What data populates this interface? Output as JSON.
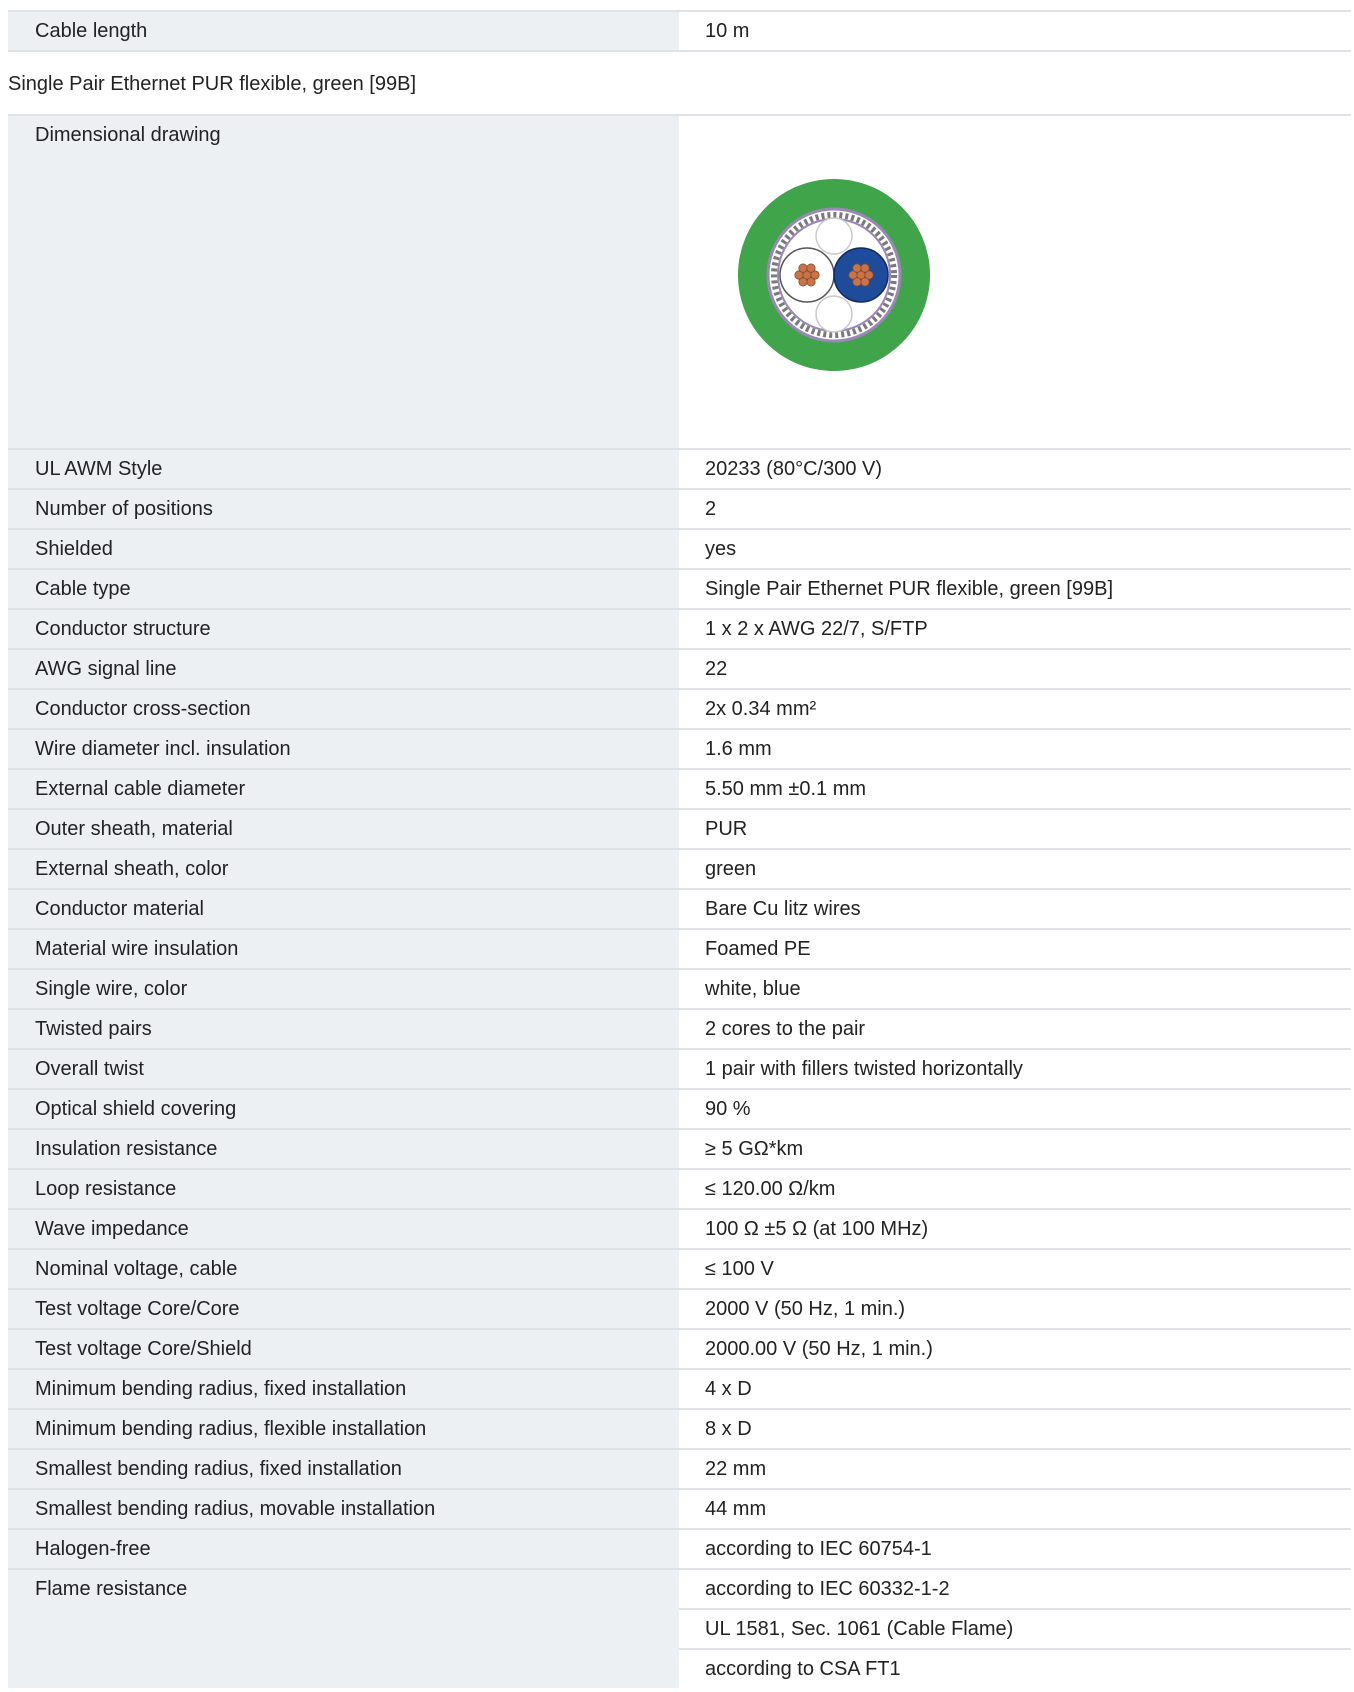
{
  "top_row": {
    "label": "Cable length",
    "value": "10 m"
  },
  "section": {
    "title": "Single Pair Ethernet PUR flexible, green [99B]",
    "drawing_label": "Dimensional drawing",
    "drawing_colors": {
      "sheath": "#3fa44a",
      "shield": "#9c86b8",
      "wire_white": "#ffffff",
      "wire_blue": "#1e4b9a",
      "copper": "#c8744a"
    },
    "rows": [
      {
        "label": "UL AWM Style",
        "values": [
          "20233 (80°C/300 V)"
        ]
      },
      {
        "label": "Number of positions",
        "values": [
          "2"
        ]
      },
      {
        "label": "Shielded",
        "values": [
          "yes"
        ]
      },
      {
        "label": "Cable type",
        "values": [
          "Single Pair Ethernet PUR flexible, green [99B]"
        ]
      },
      {
        "label": "Conductor structure",
        "values": [
          "1 x 2 x AWG 22/7, S/FTP"
        ]
      },
      {
        "label": "AWG signal line",
        "values": [
          "22"
        ]
      },
      {
        "label": "Conductor cross-section",
        "values": [
          "2x 0.34 mm²"
        ]
      },
      {
        "label": "Wire diameter incl. insulation",
        "values": [
          "1.6 mm"
        ]
      },
      {
        "label": "External cable diameter",
        "values": [
          "5.50 mm ±0.1 mm"
        ]
      },
      {
        "label": "Outer sheath, material",
        "values": [
          "PUR"
        ]
      },
      {
        "label": "External sheath, color",
        "values": [
          "green"
        ]
      },
      {
        "label": "Conductor material",
        "values": [
          "Bare Cu litz wires"
        ]
      },
      {
        "label": "Material wire insulation",
        "values": [
          "Foamed PE"
        ]
      },
      {
        "label": "Single wire, color",
        "values": [
          "white, blue"
        ]
      },
      {
        "label": "Twisted pairs",
        "values": [
          "2 cores to the pair"
        ]
      },
      {
        "label": "Overall twist",
        "values": [
          "1 pair with fillers twisted horizontally"
        ]
      },
      {
        "label": "Optical shield covering",
        "values": [
          "90 %"
        ]
      },
      {
        "label": "Insulation resistance",
        "values": [
          "≥ 5 GΩ*km"
        ]
      },
      {
        "label": "Loop resistance",
        "values": [
          "≤ 120.00 Ω/km"
        ]
      },
      {
        "label": "Wave impedance",
        "values": [
          "100 Ω ±5 Ω (at 100 MHz)"
        ]
      },
      {
        "label": "Nominal voltage, cable",
        "values": [
          "≤ 100 V"
        ]
      },
      {
        "label": "Test voltage Core/Core",
        "values": [
          "2000 V (50 Hz, 1 min.)"
        ]
      },
      {
        "label": "Test voltage Core/Shield",
        "values": [
          "2000.00 V (50 Hz, 1 min.)"
        ]
      },
      {
        "label": "Minimum bending radius, fixed installation",
        "values": [
          "4 x D"
        ]
      },
      {
        "label": "Minimum bending radius, flexible installation",
        "values": [
          "8 x D"
        ]
      },
      {
        "label": "Smallest bending radius, fixed installation",
        "values": [
          "22 mm"
        ]
      },
      {
        "label": "Smallest bending radius, movable installation",
        "values": [
          "44 mm"
        ]
      },
      {
        "label": "Halogen-free",
        "values": [
          "according to IEC 60754-1"
        ]
      },
      {
        "label": "Flame resistance",
        "values": [
          "according to IEC 60332-1-2",
          "UL 1581, Sec. 1061 (Cable Flame)",
          "according to CSA FT1"
        ]
      }
    ]
  }
}
